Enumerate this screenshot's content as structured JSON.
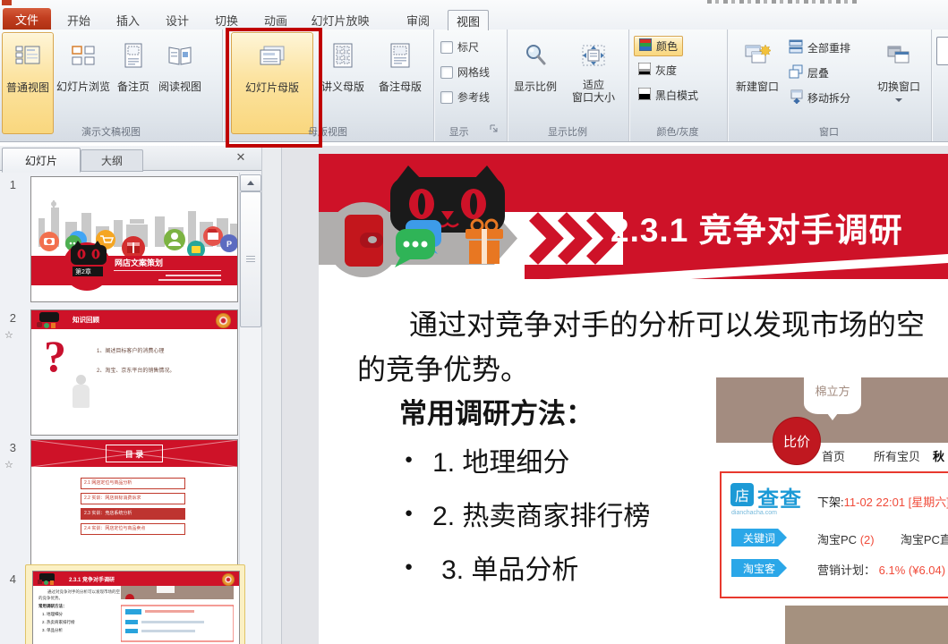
{
  "window": {
    "file_tab": "文件",
    "tabs": [
      "开始",
      "插入",
      "设计",
      "切换",
      "动画",
      "幻灯片放映",
      "审阅",
      "视图"
    ]
  },
  "ribbon": {
    "g1": {
      "label": "演示文稿视图",
      "b1": "普通视图",
      "b2": "幻灯片浏览",
      "b3": "备注页",
      "b4": "阅读视图"
    },
    "g2": {
      "label": "母版视图",
      "b1": "幻灯片母版",
      "b2": "讲义母版",
      "b3": "备注母版"
    },
    "g3": {
      "label": "显示",
      "c1": "标尺",
      "c2": "网格线",
      "c3": "参考线"
    },
    "g4": {
      "label": "显示比例",
      "b1": "显示比例",
      "b2a": "适应",
      "b2b": "窗口大小"
    },
    "g5": {
      "label": "颜色/灰度",
      "b1": "颜色",
      "b2": "灰度",
      "b3": "黑白模式"
    },
    "g6": {
      "label": "窗口",
      "b1": "新建窗口",
      "m1": "全部重排",
      "m2": "层叠",
      "m3": "移动拆分",
      "b2": "切换窗口"
    }
  },
  "pane": {
    "tab1": "幻灯片",
    "tab2": "大纲",
    "s1": {
      "num": "1",
      "title": "网店文案策划",
      "chapter": "第2章"
    },
    "s2": {
      "num": "2",
      "header": "知识回顾",
      "line1": "1、阐述目标客户的消费心理",
      "line2": "2、淘宝、京东平台的销售情况。"
    },
    "s3": {
      "num": "3",
      "header": "目 录",
      "i1": "2.1 网店定位与商品分析",
      "i2": "2.2 实训：网店目标消费诉求",
      "i3": "2.3 实训：竞店系统分析",
      "i4": "2.4 实训：网店定位与商品卖点"
    },
    "s4": {
      "num": "4"
    }
  },
  "slide": {
    "title": "2.3.1 竞争对手调研",
    "para1": "通过对竞争对手的分析可以发现市场的空",
    "para2": "的竞争优势。",
    "heading": "常用调研方法：",
    "b1": "1. 地理细分",
    "b2": "2. 热卖商家排行榜",
    "b3": "3. 单品分析"
  },
  "shop": {
    "brand": "棉立方",
    "badge": "比价",
    "nav1": "首页",
    "nav2": "所有宝贝",
    "nav3": "秋"
  },
  "dcc": {
    "logo_first": "店",
    "logo_rest": "查查",
    "domain": "dianchacha.com",
    "off_label": "下架:",
    "off_value": "11-02 22:01 [星期六]",
    "tag1": "关键词",
    "r1a": "淘宝PC",
    "r1b": "(2)",
    "r1c": "淘宝PC直",
    "tag2": "淘宝客",
    "r2a": "营销计划：",
    "r2b": "6.1%",
    "r2c": "(¥6.04)"
  },
  "colors": {
    "annotation_red": "#C00000",
    "slide_red": "#CE1228",
    "dcc_blue": "#29A3DC",
    "value_red": "#F04B3A",
    "taupe": "#A38C80"
  }
}
